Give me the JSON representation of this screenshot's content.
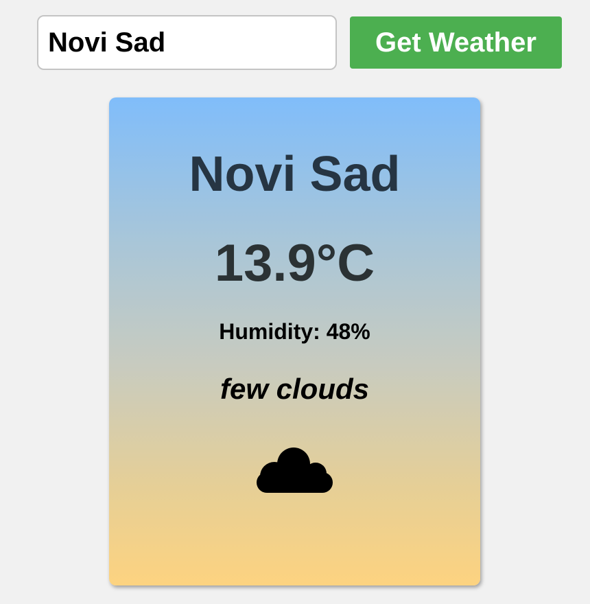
{
  "search": {
    "value": "Novi Sad",
    "button_label": "Get Weather"
  },
  "weather": {
    "city": "Novi Sad",
    "temperature": "13.9°C",
    "humidity": "Humidity: 48%",
    "description": "few clouds",
    "icon": "cloud-icon"
  },
  "colors": {
    "button": "#4caf50",
    "card_gradient_top": "#80bdfa",
    "card_gradient_bottom": "#fdd380",
    "page_background": "#f1f1f1"
  }
}
